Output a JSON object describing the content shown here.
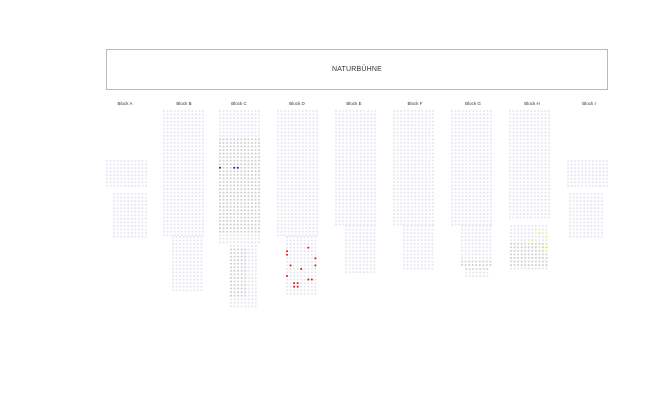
{
  "stage": {
    "label": "NATURBÜHNE"
  },
  "colors": {
    "seat_available": "#e6e6f3",
    "seat_unavailable": "#d0d0d0",
    "seat_selected_red": "#e02020",
    "seat_selected_blue": "#1a2a9a",
    "seat_highlight_yellow": "#f2ee4a",
    "stage_border": "#b9b9b9"
  },
  "blocks": [
    {
      "name": "Block A"
    },
    {
      "name": "Block B"
    },
    {
      "name": "Block C"
    },
    {
      "name": "Block D"
    },
    {
      "name": "Block E"
    },
    {
      "name": "Block F"
    },
    {
      "name": "Block G"
    },
    {
      "name": "Block H"
    },
    {
      "name": "Block I"
    }
  ]
}
